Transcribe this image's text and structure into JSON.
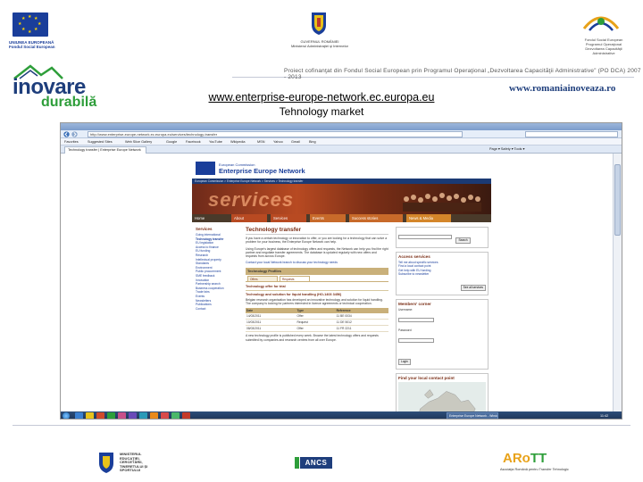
{
  "header": {
    "eu_text": [
      "UNIUNEA EUROPEANĂ",
      "Fondul Social European"
    ],
    "gov_text": [
      "GUVERNUL ROMÂNIEI",
      "Ministerul Administraţiei şi Internelor"
    ],
    "right_logo_text": [
      "Fondul Social European",
      "Programul Operaţional",
      "Dezvoltarea Capacităţii",
      "Administrative"
    ],
    "brand_word1": "inovare",
    "brand_word2": "durabilă",
    "project_line": "Proiect cofinanţat din Fondul Social European prin Programul Operaţional „Dezvoltarea Capacităţii Administrative” (PO DCA) 2007 - 2013",
    "website": "www.romaniainoveaza.ro"
  },
  "slide": {
    "url": "www.enterprise-europe-network.ec.europa.eu",
    "title": "Tehnology market"
  },
  "browser": {
    "address": "http://www.enterprise-europe-network.ec.europa.eu/services/technology-transfer",
    "favorites": [
      "Favorites",
      "Suggested Sites",
      "Web Slice Gallery",
      "Google",
      "Facebook",
      "YouTube",
      "Wikipedia",
      "MSN",
      "Yahoo",
      "Gmail",
      "Bing"
    ],
    "tab_label": "Technology transfer | Enterprise Europe Network",
    "tools": "Page ▾  Safety ▾  Tools ▾",
    "taskbar_task": "Enterprise Europe Network - Windows Internet Explorer",
    "clock": "11:42"
  },
  "een": {
    "sub": "European Commission",
    "name": "Enterprise Europe Network",
    "breadcrumb": "European Commission > Enterprise Europe Network > Services > Technology transfer",
    "banner_word": "services",
    "menu": [
      "Home",
      "About",
      "Services",
      "Events",
      "Success stories",
      "News & Media"
    ],
    "lnav_title": "Services",
    "lnav_items": [
      "Going international",
      "Technology transfer",
      "EU legislation",
      "Access to finance",
      "EU funding",
      "Research",
      "Intellectual property",
      "Standards",
      "Environment",
      "Public procurement",
      "SME feedback",
      "Innovation",
      "Partnership search",
      "Business cooperation",
      "Trade fairs",
      "Events",
      "Newsletters",
      "Publications",
      "Contact"
    ],
    "main_title": "Technology transfer",
    "intro": "If you have a certain technology or innovation to offer, or you are looking for a technology that can solve a problem for your business, the Enterprise Europe Network can help.",
    "intro2": "Using Europe's largest database of technology offers and requests, the Network can help you find the right partner and negotiate transfer agreements. The database is updated regularly with new offers and requests from across Europe.",
    "link_text": "Contact your local Network branch to discuss your technology needs",
    "box_title": "Technology Profiles",
    "box_tabs": [
      "Offers",
      "Requests"
    ],
    "sub_head": "Technology offer for trial",
    "sub_head2": "Technology and solution for liquid handling (HO-1403 3456)",
    "sub_para": "Belgian research organisation has developed an innovative technology and solution for liquid handling. The company is looking for partners interested in licence agreements or technical cooperation.",
    "table_headers": [
      "Date",
      "Type",
      "Reference"
    ],
    "table_rows": [
      [
        "14/03/2011",
        "Offer",
        "11 BE 0034"
      ],
      [
        "10/03/2011",
        "Request",
        "11 DE 5012"
      ],
      [
        "08/03/2011",
        "Offer",
        "11 FR 2211"
      ]
    ],
    "bottom_para": "A new technology profile is published every week. Browse the latest technology offers and requests submitted by companies and research centres from all over Europe.",
    "search_title": "Search",
    "search_btn": "Search",
    "access_title": "Access services",
    "access_items": [
      "Tell me about specific services",
      "Find a local contact point",
      "Get help with EU funding",
      "Subscribe to newsletter"
    ],
    "access_more": "See all services",
    "members_title": "Members' corner",
    "username_label": "Username:",
    "password_label": "Password:",
    "login_btn": "Login",
    "find_title": "Find your local contact point"
  },
  "footer": {
    "ministry_text": [
      "MINISTERUL",
      "EDUCAŢIEI,",
      "CERCETĂRII,",
      "TINERETULUI ŞI",
      "SPORTULUI"
    ],
    "ancs": "ANCS",
    "arott_1": "ARo",
    "arott_2": "TT",
    "arott_sub": "Asociaţia Română pentru Transfer Tehnologic"
  },
  "colors": {
    "eu_blue": "#1a3e9a",
    "brand_green": "#2e9e3a",
    "een_brown": "#7a2e16",
    "arott_orange": "#e8a21a"
  }
}
